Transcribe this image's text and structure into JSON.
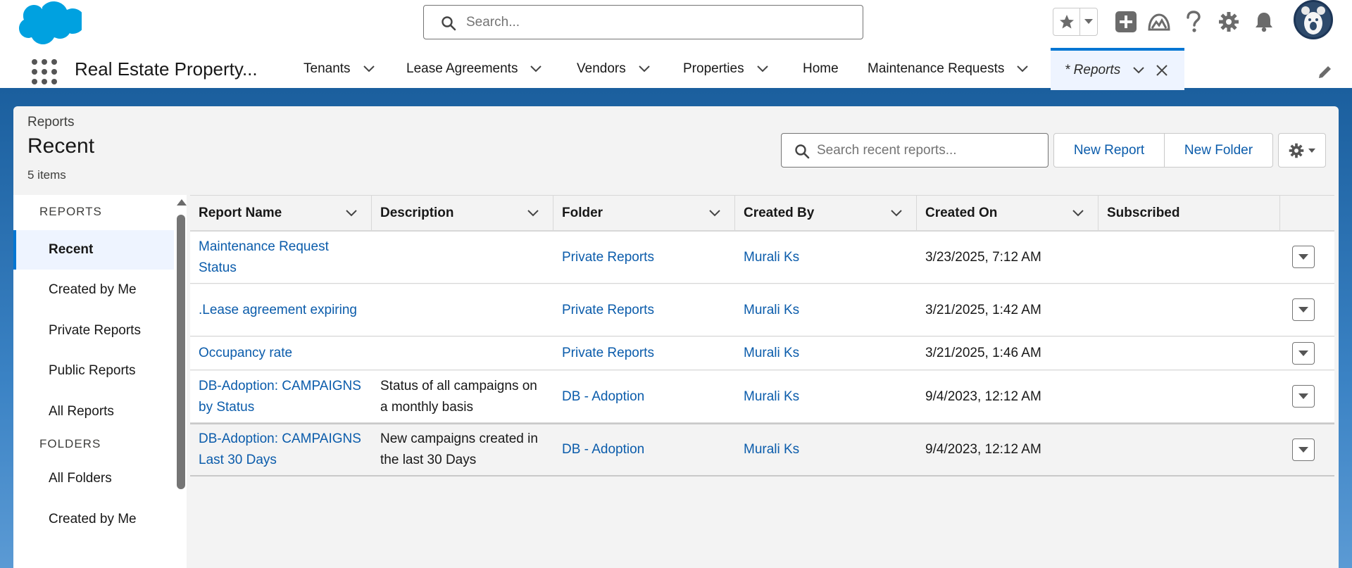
{
  "header": {
    "search_placeholder": "Search..."
  },
  "nav": {
    "app_name": "Real Estate Property...",
    "items": [
      {
        "label": "Tenants"
      },
      {
        "label": "Lease Agreements"
      },
      {
        "label": "Vendors"
      },
      {
        "label": "Properties"
      },
      {
        "label": "Home"
      },
      {
        "label": "Maintenance Requests"
      },
      {
        "label": "* Reports"
      }
    ]
  },
  "page": {
    "breadcrumb": "Reports",
    "title": "Recent",
    "item_count": "5 items",
    "search_placeholder": "Search recent reports...",
    "new_report_label": "New Report",
    "new_folder_label": "New Folder"
  },
  "sidebar": {
    "reports_heading": "REPORTS",
    "report_items": [
      {
        "label": "Recent"
      },
      {
        "label": "Created by Me"
      },
      {
        "label": "Private Reports"
      },
      {
        "label": "Public Reports"
      },
      {
        "label": "All Reports"
      }
    ],
    "folders_heading": "FOLDERS",
    "folder_items": [
      {
        "label": "All Folders"
      },
      {
        "label": "Created by Me"
      }
    ]
  },
  "table": {
    "columns": [
      "Report Name",
      "Description",
      "Folder",
      "Created By",
      "Created On",
      "Subscribed"
    ],
    "rows": [
      {
        "name": "Maintenance Request Status",
        "description": "",
        "folder": "Private Reports",
        "created_by": "Murali Ks",
        "created_on": "3/23/2025, 7:12 AM",
        "subscribed": ""
      },
      {
        "name": ".Lease agreement expiring",
        "description": "",
        "folder": "Private Reports",
        "created_by": "Murali Ks",
        "created_on": "3/21/2025, 1:42 AM",
        "subscribed": ""
      },
      {
        "name": "Occupancy rate",
        "description": "",
        "folder": "Private Reports",
        "created_by": "Murali Ks",
        "created_on": "3/21/2025, 1:46 AM",
        "subscribed": ""
      },
      {
        "name": "DB-Adoption: CAMPAIGNS by Status",
        "description": "Status of all campaigns on a monthly basis",
        "folder": "DB - Adoption",
        "created_by": "Murali Ks",
        "created_on": "9/4/2023, 12:12 AM",
        "subscribed": ""
      },
      {
        "name": "DB-Adoption: CAMPAIGNS Last 30 Days",
        "description": "New campaigns created in the last 30 Days",
        "folder": "DB - Adoption",
        "created_by": "Murali Ks",
        "created_on": "9/4/2023, 12:12 AM",
        "subscribed": ""
      }
    ]
  },
  "icons": {
    "logo": "salesforce-cloud-logo",
    "search": "search-icon",
    "favorite": "star-icon",
    "add": "plus-icon",
    "trailhead": "trailhead-icon",
    "help": "question-icon",
    "setup": "gear-icon",
    "notifications": "bell-icon",
    "edit_nav": "pencil-icon",
    "row_menu": "chevron-down-icon"
  },
  "colors": {
    "brand_blue": "#0176d3",
    "link_blue": "#0b5cab",
    "logo_blue": "#00a1e0",
    "banner_blue": "#1b5f9e"
  }
}
